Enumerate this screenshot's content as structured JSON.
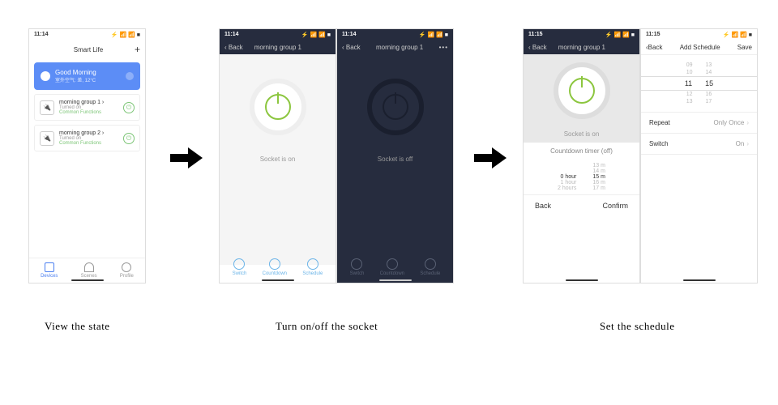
{
  "status_time_a": "11:14",
  "status_time_b": "11:15",
  "status_icons": "⚡  📶 📶 ■",
  "captions": {
    "view": "View the state",
    "toggle": "Turn on/off the socket",
    "schedule": "Set the schedule"
  },
  "phone1": {
    "title": "Smart Life",
    "plus": "+",
    "banner_title": "Good Morning",
    "banner_sub": "室外空气: 差, 12°C",
    "dev1_name": "morning group 1",
    "dev1_status": "Turned on",
    "dev1_cf": "Common Functions",
    "dev2_name": "morning group 2",
    "dev2_status": "Turned on",
    "dev2_cf": "Common Functions",
    "tab1": "Devices",
    "tab2": "Scenes",
    "tab3": "Profile"
  },
  "phone2": {
    "back": "Back",
    "title": "morning group 1",
    "status": "Socket is on",
    "t1": "Switch",
    "t2": "Countdown",
    "t3": "Schedule"
  },
  "phone3": {
    "back": "Back",
    "title": "morning group 1",
    "status": "Socket is off",
    "t1": "Switch",
    "t2": "Countdown",
    "t3": "Schedule",
    "more": "•••"
  },
  "phone4": {
    "back": "Back",
    "title": "morning group 1",
    "status": "Socket is on",
    "cd_title": "Countdown timer (off)",
    "h0": "0 hour",
    "h1": "1 hour",
    "h2": "2 hours",
    "m13": "13 m",
    "m14": "14 m",
    "m15": "15 m",
    "m16": "16 m",
    "m17": "17 m",
    "btn_back": "Back",
    "btn_conf": "Confirm"
  },
  "phone5": {
    "back": "Back",
    "title": "Add Schedule",
    "save": "Save",
    "r09": "09",
    "r10": "10",
    "r11": "11",
    "r12": "12",
    "r13": "13",
    "r14": "14",
    "r15": "15",
    "r16": "16",
    "r17": "17",
    "rA": "13",
    "repeat_l": "Repeat",
    "repeat_v": "Only Once",
    "switch_l": "Switch",
    "switch_v": "On"
  }
}
